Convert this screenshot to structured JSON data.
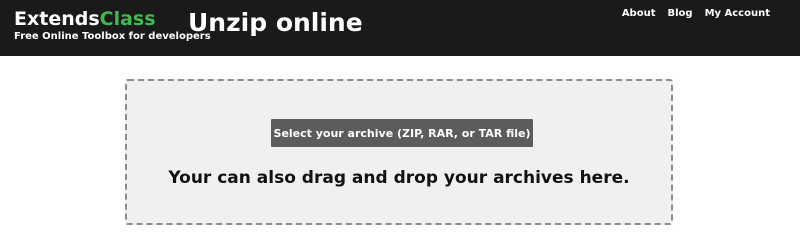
{
  "header": {
    "logo_prefix": "Extends",
    "logo_accent": "Class",
    "tagline": "Free Online Toolbox for developers",
    "title": "Unzip online",
    "nav": [
      {
        "label": "About"
      },
      {
        "label": "Blog"
      },
      {
        "label": "My Account"
      }
    ]
  },
  "dropzone": {
    "button_label": "Select your archive (ZIP, RAR, or TAR file)",
    "hint": "Your can also drag and drop your archives here."
  },
  "colors": {
    "header_bg": "#1a1a1a",
    "brand_accent": "#3fb950",
    "button_bg": "#5c5c5c",
    "dropzone_bg": "#f0f0f0"
  }
}
